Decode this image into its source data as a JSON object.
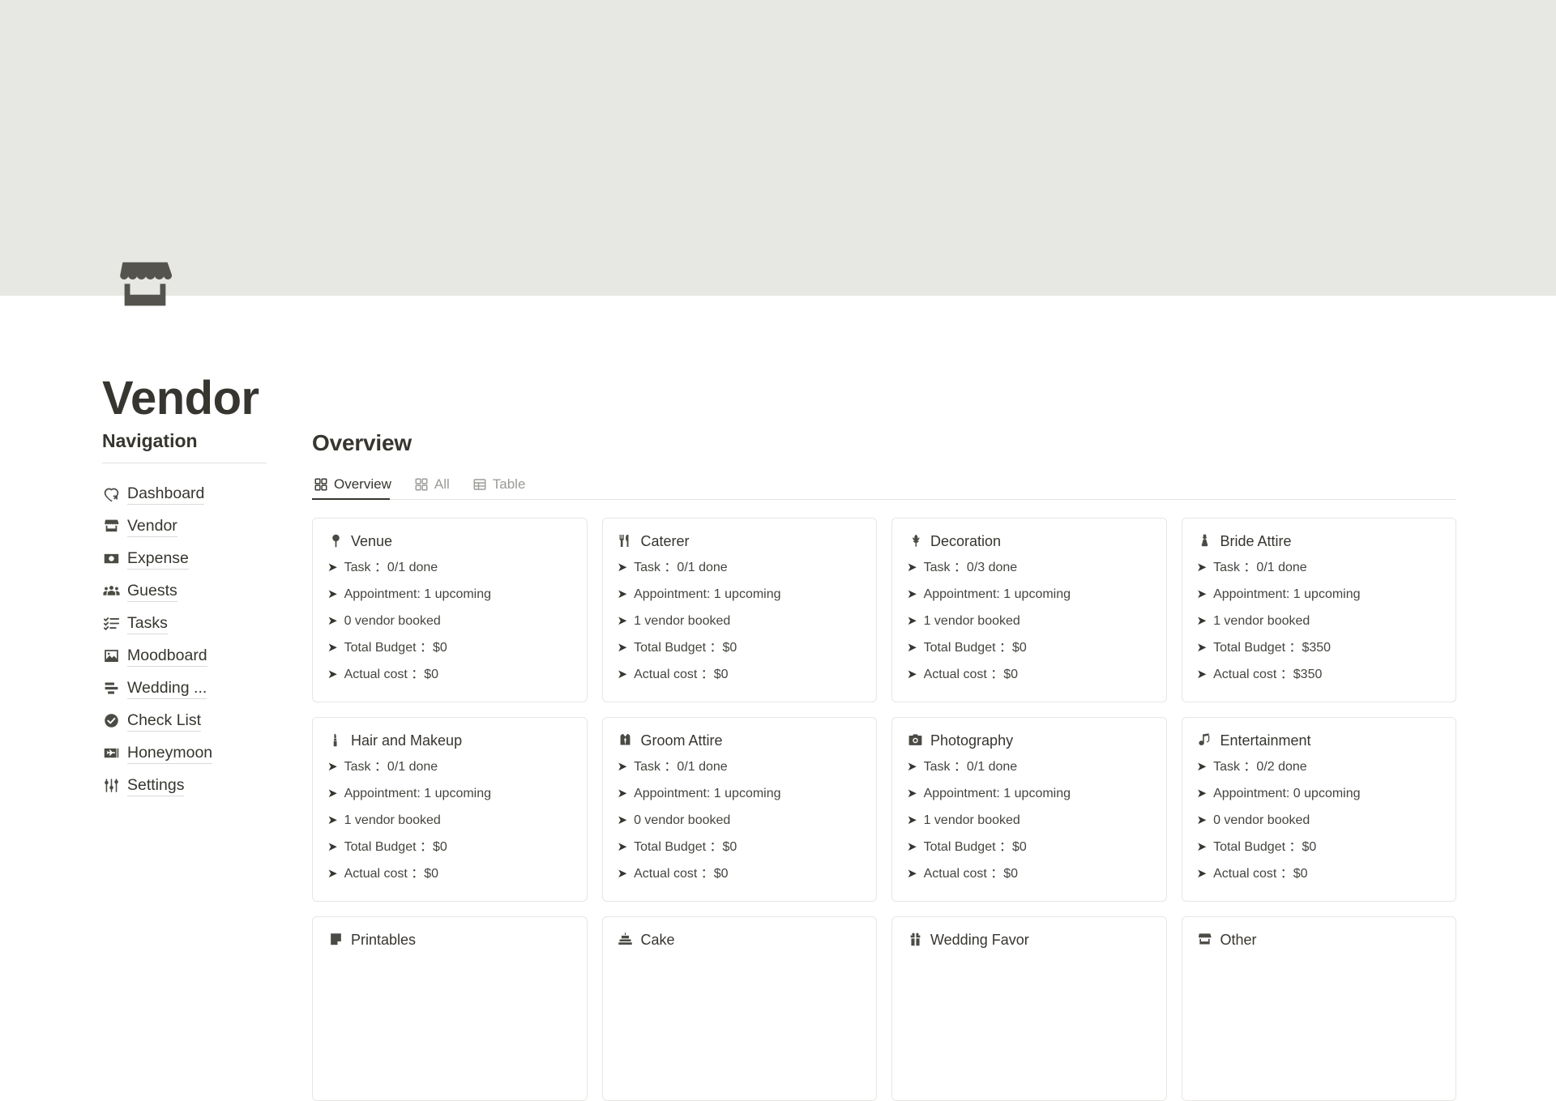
{
  "page": {
    "title": "Vendor",
    "icon": "storefront-icon"
  },
  "sidebar": {
    "heading": "Navigation",
    "items": [
      {
        "label": "Dashboard",
        "icon": "heart-arrow-icon"
      },
      {
        "label": "Vendor",
        "icon": "storefront-icon"
      },
      {
        "label": "Expense",
        "icon": "money-bill-icon"
      },
      {
        "label": "Guests",
        "icon": "people-group-icon"
      },
      {
        "label": "Tasks",
        "icon": "checklist-icon"
      },
      {
        "label": "Moodboard",
        "icon": "image-icon"
      },
      {
        "label": "Wedding ...",
        "icon": "timeline-icon"
      },
      {
        "label": "Check List",
        "icon": "check-circle-icon"
      },
      {
        "label": "Honeymoon",
        "icon": "plane-ticket-icon"
      },
      {
        "label": "Settings",
        "icon": "sliders-icon"
      }
    ]
  },
  "main": {
    "title": "Overview",
    "tabs": [
      {
        "label": "Overview",
        "icon": "gallery-icon",
        "active": true
      },
      {
        "label": "All",
        "icon": "gallery-icon",
        "active": false
      },
      {
        "label": "Table",
        "icon": "table-icon",
        "active": false
      }
    ],
    "cards": [
      {
        "title": "Venue",
        "icon": "pin-icon",
        "lines": [
          "Task ：0/1 done",
          "Appointment: 1 upcoming",
          "0 vendor booked",
          "Total Budget ：$0",
          "Actual cost ：$0"
        ]
      },
      {
        "title": "Caterer",
        "icon": "fork-knife-icon",
        "lines": [
          "Task ：0/1 done",
          "Appointment: 1 upcoming",
          "1 vendor booked",
          "Total Budget ：$0",
          "Actual cost ：$0"
        ]
      },
      {
        "title": "Decoration",
        "icon": "tulip-icon",
        "lines": [
          "Task ：0/3 done",
          "Appointment: 1 upcoming",
          "1 vendor booked",
          "Total Budget ：$0",
          "Actual cost ：$0"
        ]
      },
      {
        "title": "Bride Attire",
        "icon": "dress-icon",
        "lines": [
          "Task ：0/1 done",
          "Appointment: 1 upcoming",
          "1 vendor booked",
          "Total Budget ：$350",
          "Actual cost ：$350"
        ]
      },
      {
        "title": "Hair and Makeup",
        "icon": "lipstick-icon",
        "lines": [
          "Task ：0/1 done",
          "Appointment: 1 upcoming",
          "1 vendor booked",
          "Total Budget ：$0",
          "Actual cost ：$0"
        ]
      },
      {
        "title": "Groom Attire",
        "icon": "suit-icon",
        "lines": [
          "Task ：0/1 done",
          "Appointment: 1 upcoming",
          "0 vendor booked",
          "Total Budget ：$0",
          "Actual cost ：$0"
        ]
      },
      {
        "title": "Photography",
        "icon": "camera-icon",
        "lines": [
          "Task ：0/1 done",
          "Appointment: 1 upcoming",
          "1 vendor booked",
          "Total Budget ：$0",
          "Actual cost ：$0"
        ]
      },
      {
        "title": "Entertainment",
        "icon": "music-note-icon",
        "lines": [
          "Task ：0/2 done",
          "Appointment: 0 upcoming",
          "0 vendor booked",
          "Total Budget ：$0",
          "Actual cost ：$0"
        ]
      },
      {
        "title": "Printables",
        "icon": "note-icon",
        "lines": []
      },
      {
        "title": "Cake",
        "icon": "cake-icon",
        "lines": []
      },
      {
        "title": "Wedding Favor",
        "icon": "gift-icon",
        "lines": []
      },
      {
        "title": "Other",
        "icon": "storefront-icon",
        "lines": []
      }
    ]
  },
  "colors": {
    "cover": "#e7e7e3",
    "text": "#37352f",
    "muted": "#9b9a97",
    "border": "#e7e6e3",
    "icon": "#4c4a45"
  }
}
